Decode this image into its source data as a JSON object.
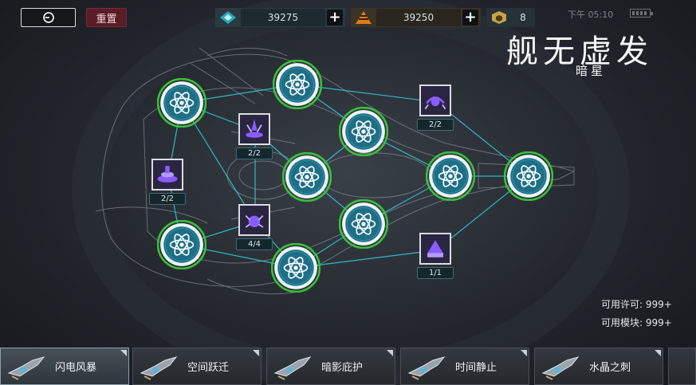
{
  "topbar": {
    "back_icon": "exit-icon",
    "reset_label": "重置",
    "resources": [
      {
        "icon": "crystal-icon",
        "value": "39275",
        "color": "#2aa6b8"
      },
      {
        "icon": "ore-icon",
        "value": "39250",
        "color": "#e07a1a"
      },
      {
        "icon": "module-box-icon",
        "value": "8",
        "color": "#c9a248"
      }
    ],
    "status_text": "下午 05:10"
  },
  "title": {
    "main": "舰无虚发",
    "sub": "暗星"
  },
  "tree": {
    "nodes": [
      {
        "type": "atom"
      },
      {
        "type": "atom"
      },
      {
        "type": "atom"
      },
      {
        "type": "atom"
      },
      {
        "type": "atom"
      },
      {
        "type": "atom"
      },
      {
        "type": "atom"
      },
      {
        "type": "atom"
      },
      {
        "type": "atom"
      }
    ],
    "modules": [
      {
        "icon": "module-claw-icon",
        "count": "2/2"
      },
      {
        "icon": "module-spire-icon",
        "count": "2/2"
      },
      {
        "icon": "module-disc-icon",
        "count": "2/2"
      },
      {
        "icon": "module-crab-icon",
        "count": "4/4"
      },
      {
        "icon": "module-cap-icon",
        "count": "1/1"
      }
    ],
    "colors": {
      "link": "#2fd0e0",
      "node_ring": "#38c23a",
      "node_fill": "#1e6f86",
      "module_glow": "#8a5cff"
    }
  },
  "info": {
    "permits": "可用许可: 999+",
    "modules": "可用模块: 999+"
  },
  "ships": [
    {
      "label": "闪电风暴",
      "active": true
    },
    {
      "label": "空间跃迁",
      "active": false
    },
    {
      "label": "暗影庇护",
      "active": false
    },
    {
      "label": "时间静止",
      "active": false
    },
    {
      "label": "水晶之刺",
      "active": false
    }
  ]
}
